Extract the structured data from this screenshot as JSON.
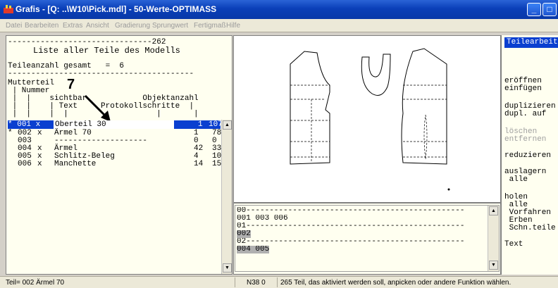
{
  "window": {
    "title": "Grafis - [Q: ..\\W10\\Pick.mdl] - 50-Werte-OPTIMASS",
    "min_label": "_",
    "max_label": "□"
  },
  "menu": [
    "Datei",
    "Bearbeiten",
    "Extras",
    "Ansicht",
    "Gradierung",
    "Sprungwert",
    "Fertigmaß",
    "Hilfe"
  ],
  "left_panel": {
    "header_line": "-------------------------------262",
    "heading": "     Liste aller Teile des Modells",
    "count_line": "Teileanzahl gesamt   =  6",
    "rule": "----------------------------------------",
    "col_lines": [
      "Mutterteil",
      " | Nummer",
      " |  |    sichtbar            Objektanzahl",
      " |  |    | Text     Protokollschritte  |",
      " |  |    |  |                   |       |"
    ],
    "annotation_number": "7",
    "rows": [
      {
        "mark": "*",
        "num": "001",
        "vis": "x",
        "text": "Oberteil 30",
        "obj": "1",
        "steps": "107",
        "selected": true
      },
      {
        "mark": "*",
        "num": "002",
        "vis": "x",
        "text": "Ärmel 70",
        "obj": "1",
        "steps": "78"
      },
      {
        "mark": " ",
        "num": "003",
        "vis": " ",
        "text": "--------------------",
        "obj": "0",
        "steps": "0"
      },
      {
        "mark": " ",
        "num": "004",
        "vis": "x",
        "text": "Ärmel",
        "obj": "42",
        "steps": "33"
      },
      {
        "mark": " ",
        "num": "005",
        "vis": "x",
        "text": "Schlitz-Beleg",
        "obj": "4",
        "steps": "10"
      },
      {
        "mark": " ",
        "num": "006",
        "vis": "x",
        "text": "Manchette",
        "obj": "14",
        "steps": "15"
      }
    ],
    "edit_value": "Oberteil 30"
  },
  "history": {
    "lines": [
      {
        "text": "00-----------------------------------------------",
        "hl": false
      },
      {
        "text": "001 003 006",
        "hl": false
      },
      {
        "text": "01-----------------------------------------------",
        "hl": false
      },
      {
        "text": "002",
        "hl": true
      },
      {
        "text": "02-----------------------------------------------",
        "hl": false
      },
      {
        "text": "004 005",
        "hl": true
      }
    ]
  },
  "right_panel": {
    "title": "Teilearbeiten",
    "items": [
      {
        "text": "eröffnen",
        "enabled": true
      },
      {
        "text": "einfügen",
        "enabled": true
      },
      {
        "text": "duplizieren",
        "enabled": true
      },
      {
        "text": "dupl. auf",
        "enabled": true
      },
      {
        "text": "löschen",
        "enabled": false
      },
      {
        "text": "entfernen",
        "enabled": false
      },
      {
        "text": "reduzieren",
        "enabled": true
      },
      {
        "text": "auslagern",
        "enabled": true
      },
      {
        "text": " alle",
        "enabled": true
      },
      {
        "text": "holen",
        "enabled": true
      },
      {
        "text": " alle",
        "enabled": true
      },
      {
        "text": " Vorfahren",
        "enabled": true
      },
      {
        "text": " Erben",
        "enabled": true
      },
      {
        "text": " Schn.teile",
        "enabled": true
      },
      {
        "text": "Text",
        "enabled": true
      }
    ]
  },
  "status": {
    "part": "Teil= 002 Ärmel 70",
    "coord": "N38 0",
    "message": "265 Teil, das aktiviert werden soll, anpicken oder andere Funktion wählen."
  },
  "colors": {
    "title_bar": "#0a3fb8",
    "selection": "#0a3fd0",
    "panel_bg": "#fffff0"
  }
}
